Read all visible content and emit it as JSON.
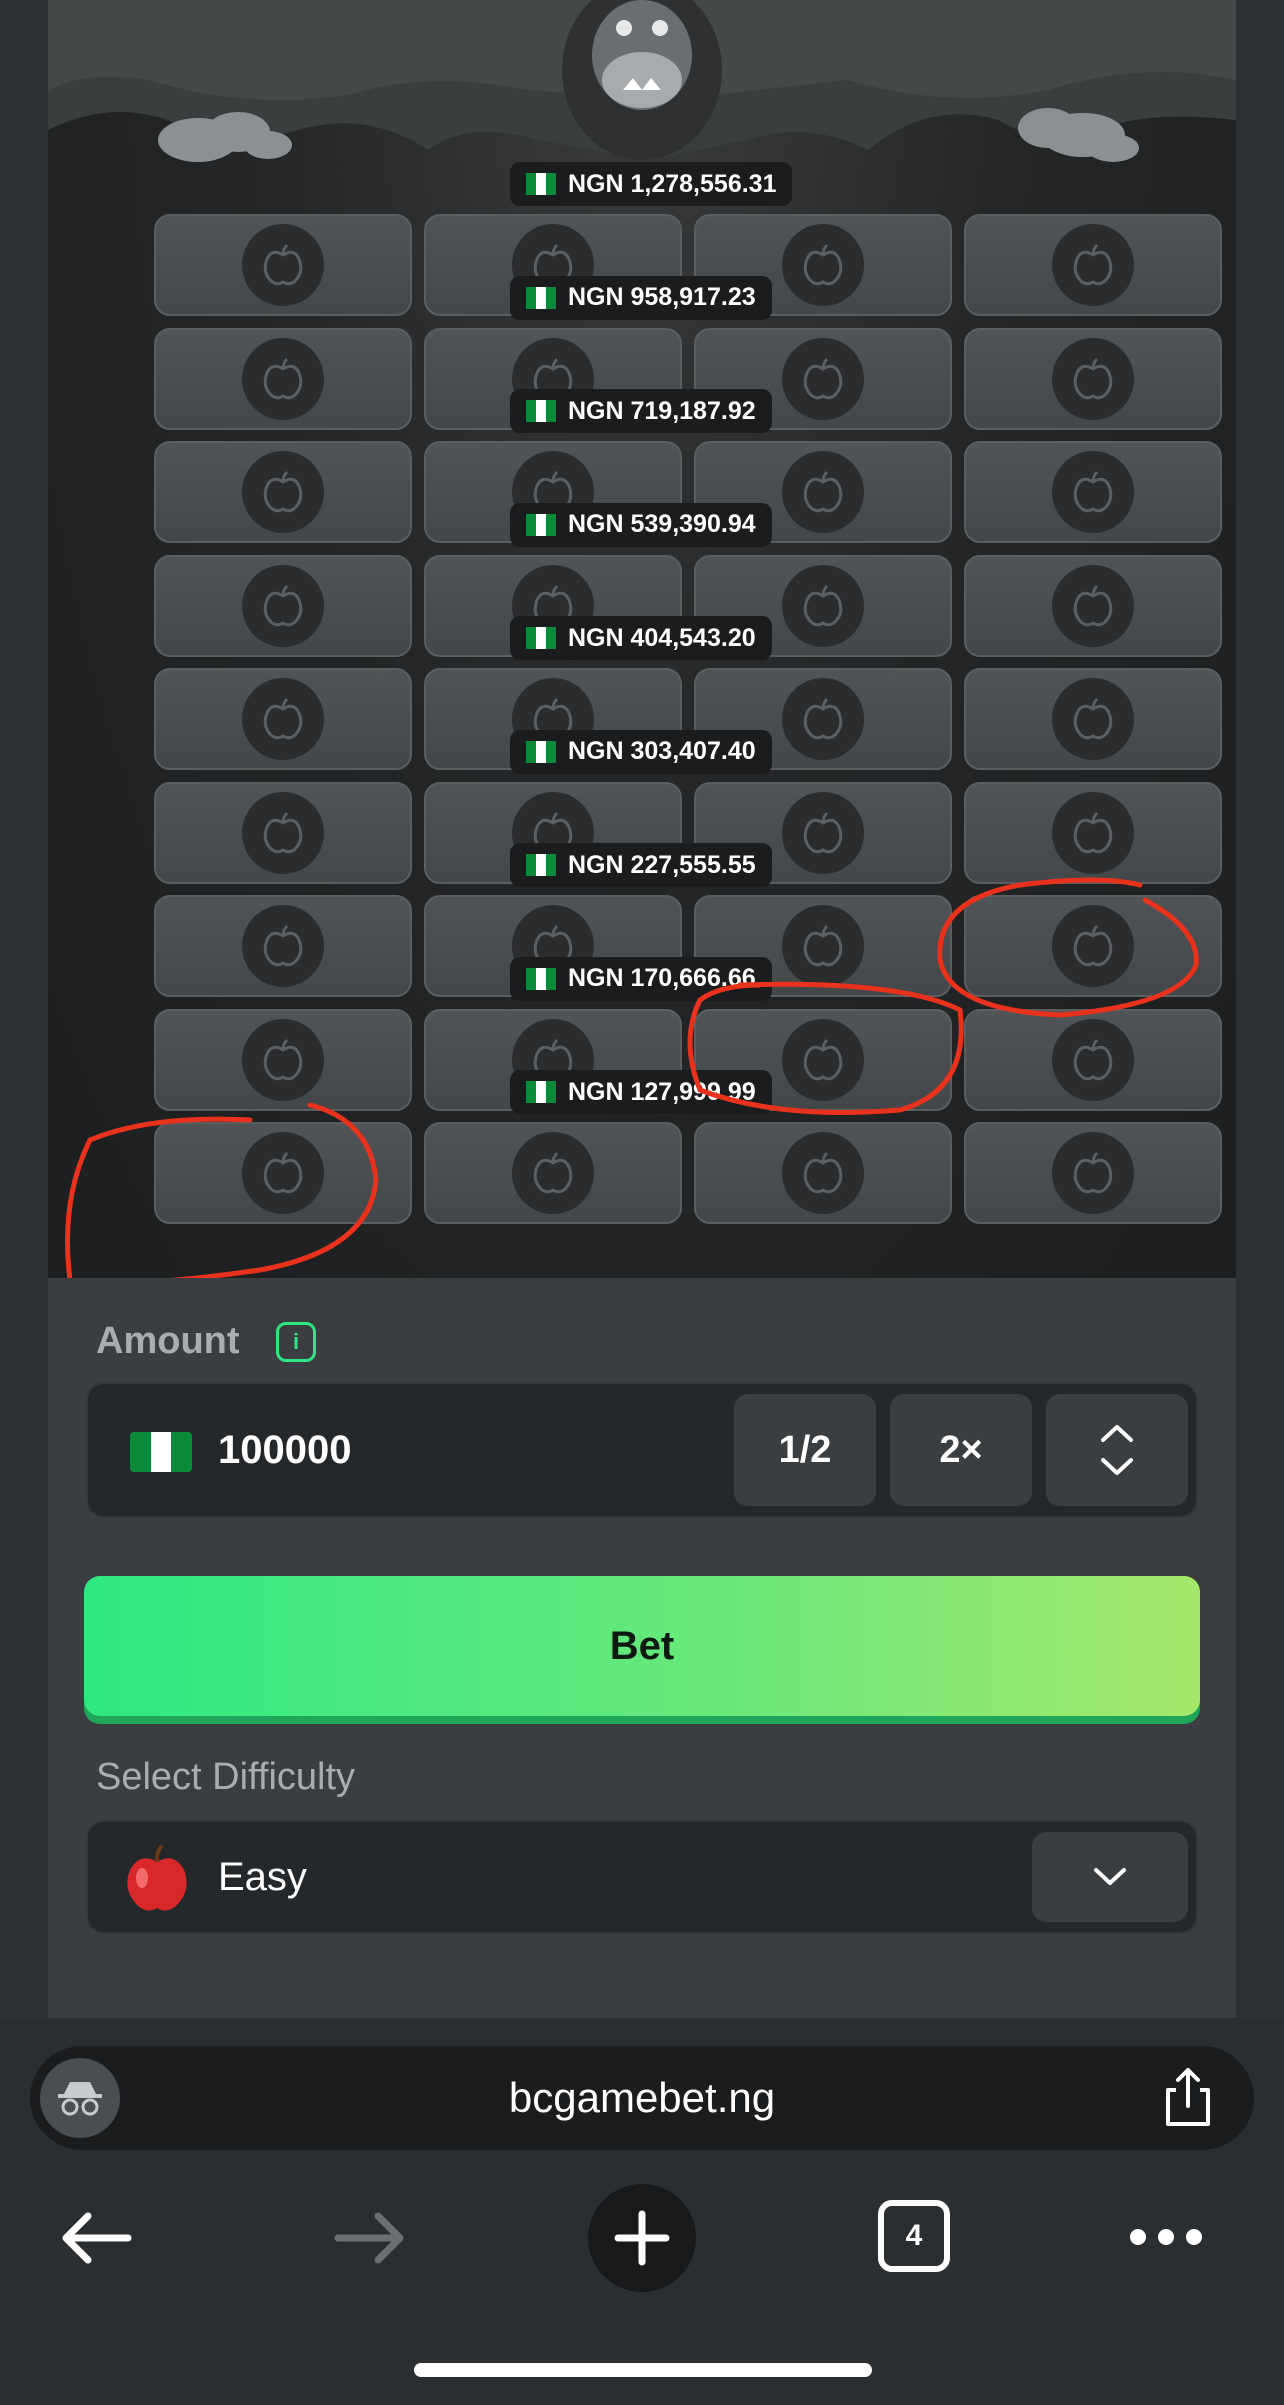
{
  "payouts": [
    "NGN 1,278,556.31",
    "NGN 958,917.23",
    "NGN 719,187.92",
    "NGN 539,390.94",
    "NGN 404,543.20",
    "NGN 303,407.40",
    "NGN 227,555.55",
    "NGN 170,666.66",
    "NGN 127,999.99"
  ],
  "grid": {
    "rows": 9,
    "columns": 4,
    "tile_icon": "apple-icon"
  },
  "amount": {
    "label": "Amount",
    "value": "100000",
    "currency_icon": "nigeria-flag-icon",
    "half_label": "1/2",
    "double_label": "2×"
  },
  "bet_button": {
    "label": "Bet"
  },
  "difficulty": {
    "label": "Select Difficulty",
    "value": "Easy",
    "icon": "red-apple-icon"
  },
  "browser": {
    "url": "bcgamebet.ng",
    "tab_count": "4"
  },
  "colors": {
    "accent_green": "#2de882",
    "annotation_red": "#e8321c",
    "flag_green": "#0a8a3a"
  }
}
